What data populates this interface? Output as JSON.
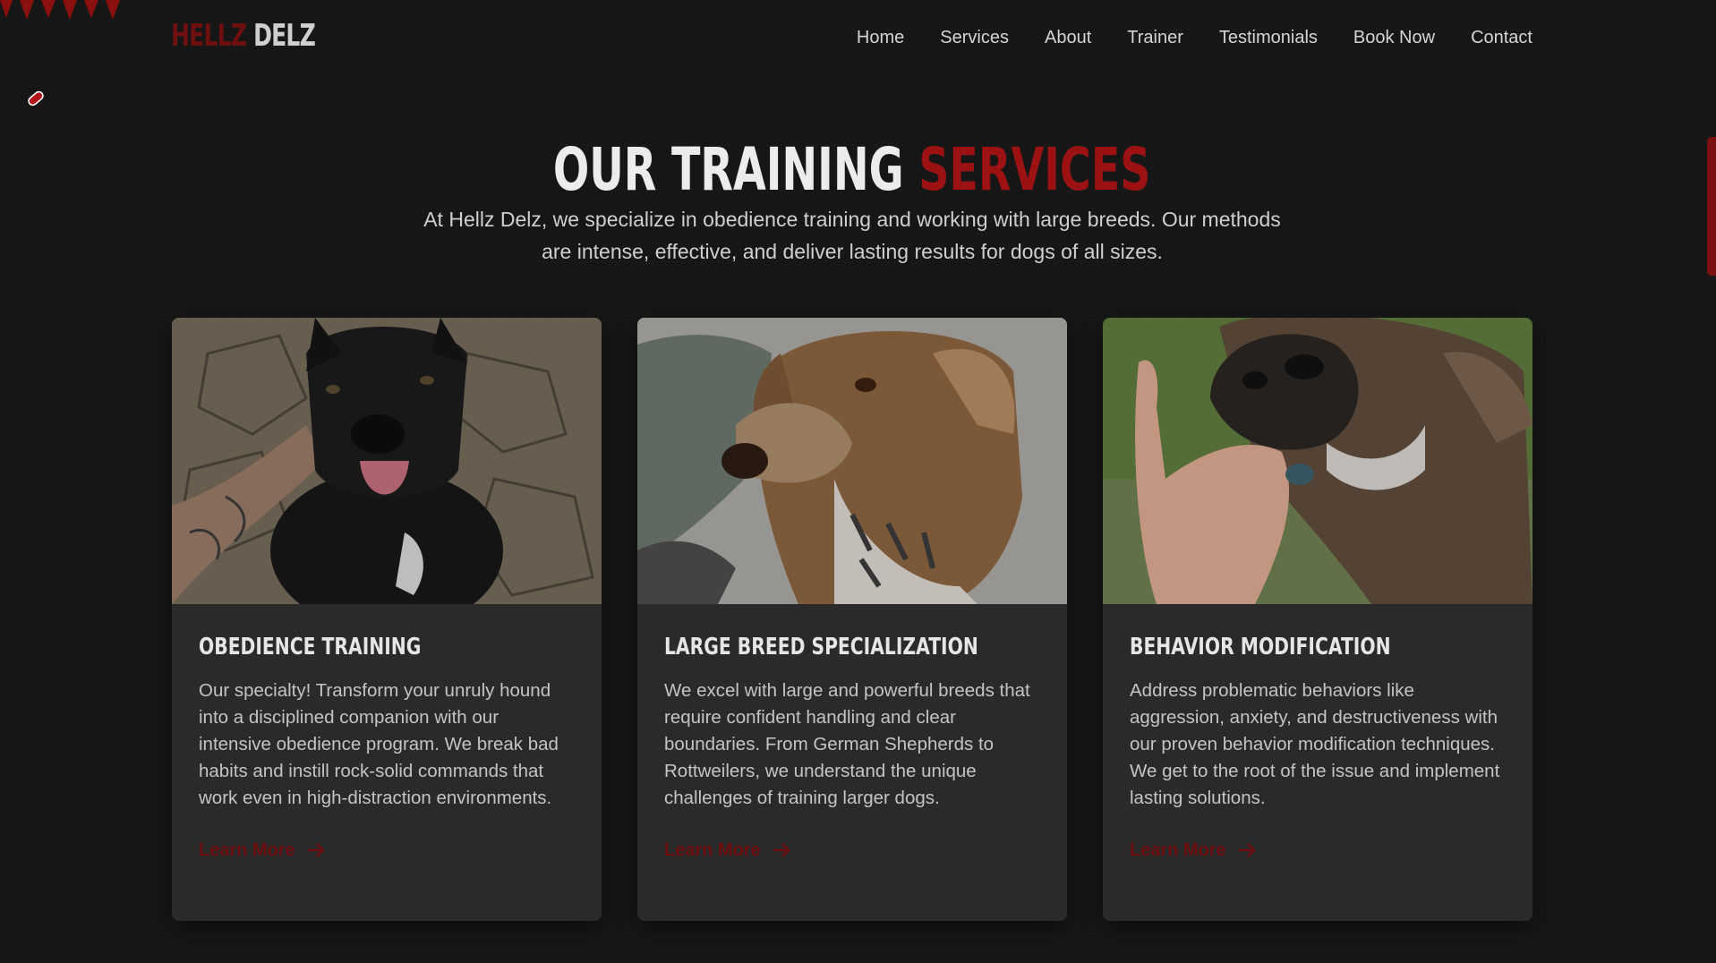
{
  "brand": {
    "logo_part1": "HELLZ",
    "logo_part2": "DELZ"
  },
  "nav": {
    "items": [
      "Home",
      "Services",
      "About",
      "Trainer",
      "Testimonials",
      "Book Now",
      "Contact"
    ]
  },
  "section": {
    "title_part1": "OUR TRAINING",
    "title_part2": "SERVICES",
    "intro": "At Hellz Delz, we specialize in obedience training and working with large breeds. Our methods are intense, effective, and deliver lasting results for dogs of all sizes."
  },
  "cards": [
    {
      "title": "OBEDIENCE TRAINING",
      "text": "Our specialty! Transform your unruly hound into a disciplined companion with our intensive obedience program. We break bad habits and instill rock-solid commands that work even in high-distraction environments.",
      "link": "Learn More",
      "photo": "black dog with pink tongue being petted on stone patio"
    },
    {
      "title": "LARGE BREED SPECIALIZATION",
      "text": "We excel with large and powerful breeds that require confident handling and clear boundaries. From German Shepherds to Rottweilers, we understand the unique challenges of training larger dogs.",
      "link": "Learn More",
      "photo": "brown and speckled hound looking sideways"
    },
    {
      "title": "BEHAVIOR MODIFICATION",
      "text": "Address problematic behaviors like aggression, anxiety, and destructiveness with our proven behavior modification techniques. We get to the root of the issue and implement lasting solutions.",
      "link": "Learn More",
      "photo": "dark dog taking a treat from a hand"
    }
  ],
  "colors": {
    "background": "#161616",
    "card": "#2a2a2a",
    "accent_red": "#9c1212",
    "link_red": "#6e0e0e",
    "text": "#c4c4c4"
  },
  "icons": [
    "teeth-decoration-icon",
    "bone-icon",
    "arrow-right-icon"
  ]
}
